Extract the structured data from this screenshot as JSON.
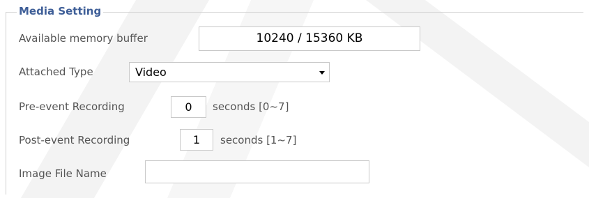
{
  "section": {
    "legend": "Media Setting"
  },
  "memory_buffer": {
    "label": "Available memory buffer",
    "value": "10240 / 15360 KB"
  },
  "attached_type": {
    "label": "Attached Type",
    "selected": "Video"
  },
  "pre_event": {
    "label": "Pre-event Recording",
    "value": "0",
    "unit": "seconds [0~7]"
  },
  "post_event": {
    "label": "Post-event Recording",
    "value": "1",
    "unit": "seconds [1~7]"
  },
  "image_file_name": {
    "label": "Image File Name",
    "value": ""
  },
  "colors": {
    "legend": "#3f5f98",
    "label": "#555555",
    "border": "#c8c8c8"
  }
}
